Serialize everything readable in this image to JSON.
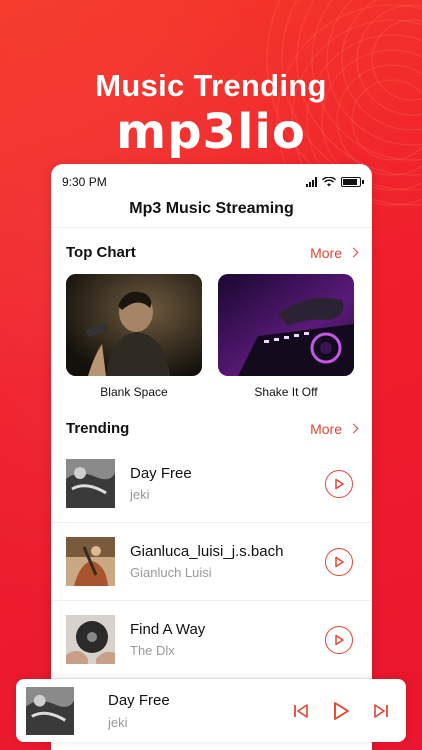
{
  "promo": {
    "headline": "Music Trending",
    "brand": "mp3lio"
  },
  "status_bar": {
    "time": "9:30 PM"
  },
  "app": {
    "title": "Mp3 Music Streaming"
  },
  "top_chart": {
    "title": "Top Chart",
    "more_label": "More",
    "items": [
      {
        "label": "Blank Space"
      },
      {
        "label": "Shake It Off"
      }
    ]
  },
  "trending": {
    "title": "Trending",
    "more_label": "More",
    "tracks": [
      {
        "title": "Day Free",
        "artist": "jeki"
      },
      {
        "title": "Gianluca_luisi_j.s.bach",
        "artist": "Gianluch Luisi"
      },
      {
        "title": "Find A Way",
        "artist": "The Dlx"
      }
    ]
  },
  "player": {
    "title": "Day Free",
    "artist": "jeki"
  },
  "colors": {
    "accent": "#e8432f",
    "background": "#f4262a"
  }
}
